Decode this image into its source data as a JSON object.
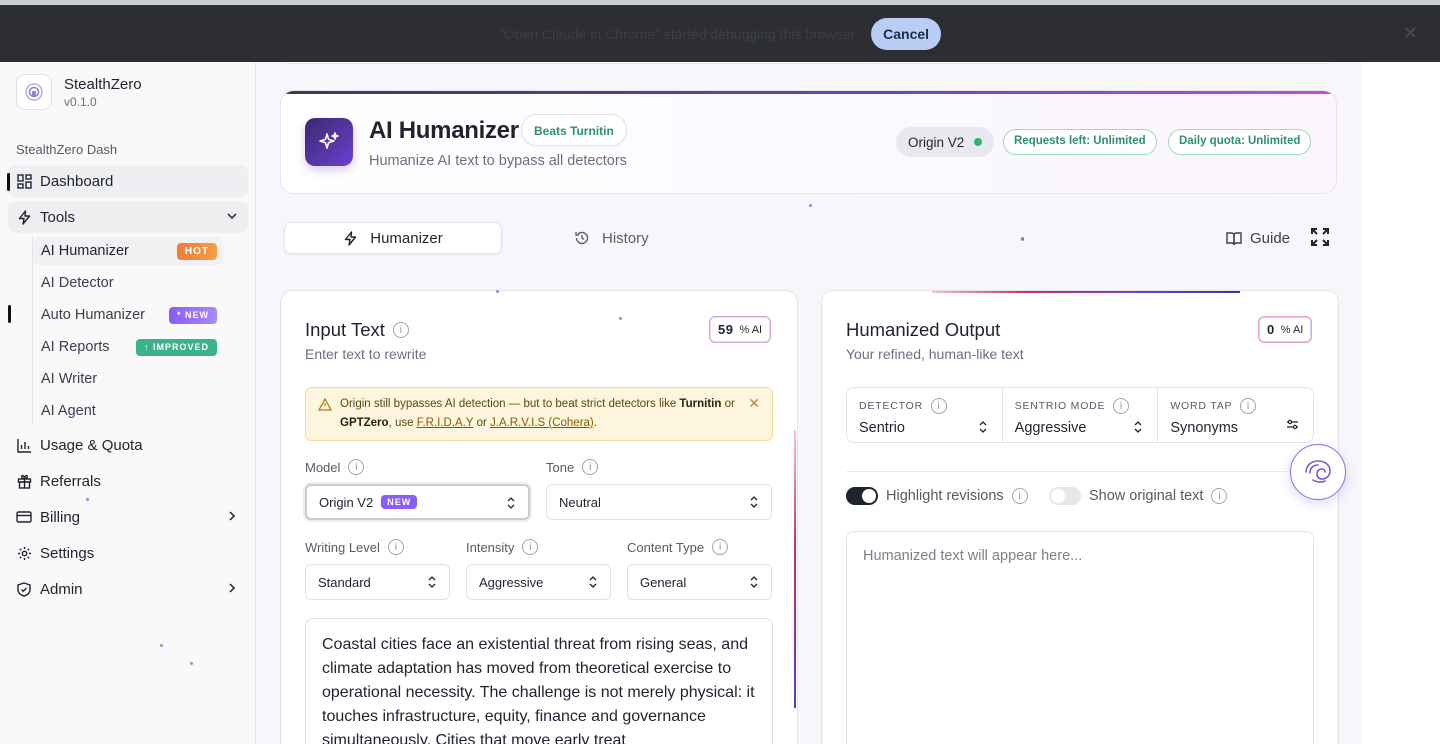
{
  "debug_bar": {
    "message": "\"Open Claude in Chrome\" started debugging this browser",
    "cancel_label": "Cancel",
    "close_glyph": "✕"
  },
  "sidebar": {
    "brand_name": "StealthZero",
    "brand_version": "v0.1.0",
    "section_label": "StealthZero Dash",
    "items": [
      {
        "label": "Dashboard",
        "icon": "dashboard-icon"
      },
      {
        "label": "Tools",
        "icon": "bolt-icon"
      },
      {
        "label": "Usage & Quota",
        "icon": "bar-chart-icon"
      },
      {
        "label": "Referrals",
        "icon": "gift-icon"
      },
      {
        "label": "Billing",
        "icon": "credit-card-icon"
      },
      {
        "label": "Settings",
        "icon": "gear-icon"
      },
      {
        "label": "Admin",
        "icon": "shield-icon"
      }
    ],
    "tools": [
      {
        "label": "AI Humanizer",
        "badge": "HOT"
      },
      {
        "label": "AI Detector",
        "badge": ""
      },
      {
        "label": "Auto Humanizer",
        "badge": "* NEW"
      },
      {
        "label": "AI Reports",
        "badge": "↑ IMPROVED"
      },
      {
        "label": "AI Writer",
        "badge": ""
      },
      {
        "label": "AI Agent",
        "badge": ""
      }
    ]
  },
  "header": {
    "title": "AI Humanizer",
    "chip": "Beats Turnitin",
    "subtitle": "Humanize AI text to bypass all detectors",
    "model": "Origin V2",
    "requests": "Requests left: Unlimited",
    "quota": "Daily quota: Unlimited"
  },
  "tabs": {
    "humanizer": "Humanizer",
    "history": "History",
    "guide": "Guide"
  },
  "input": {
    "title": "Input Text",
    "subtitle": "Enter text to rewrite",
    "ai_percent": "59",
    "ai_unit": "% AI",
    "warning": {
      "pre": "Origin still bypasses AI detection — but to beat strict detectors like ",
      "turnitin": "Turnitin",
      "or": " or ",
      "gptzero": "GPTZero",
      "use": ", use ",
      "friday": "F.R.I.D.A.Y",
      "or2": " or ",
      "jarvis": "J.A.R.V.I.S (Cohera)",
      "end": "."
    },
    "model_label": "Model",
    "model_value": "Origin V2",
    "model_badge": "NEW",
    "tone_label": "Tone",
    "tone_value": "Neutral",
    "writing_level_label": "Writing Level",
    "writing_level_value": "Standard",
    "intensity_label": "Intensity",
    "intensity_value": "Aggressive",
    "content_type_label": "Content Type",
    "content_type_value": "General",
    "text": "Coastal cities face an existential threat from rising seas, and climate adaptation has moved from theoretical exercise to operational necessity. The challenge is not merely physical: it touches infrastructure, equity, finance and governance simultaneously. Cities that move early treat"
  },
  "output": {
    "title": "Humanized Output",
    "subtitle": "Your refined, human-like text",
    "ai_percent": "0",
    "ai_unit": "% AI",
    "detector_label": "DETECTOR",
    "detector_value": "Sentrio",
    "mode_label": "SENTRIO MODE",
    "mode_value": "Aggressive",
    "word_tap_label": "WORD TAP",
    "word_tap_value": "Synonyms",
    "highlight_label": "Highlight revisions",
    "highlight_on": true,
    "original_label": "Show original text",
    "original_on": false,
    "placeholder": "Humanized text will appear here..."
  },
  "colors": {
    "accent": "#6d3fd0",
    "success": "#2f8f6e",
    "hot": "#f07a3c",
    "new": "#8b5cf6",
    "improved": "#3bb38a"
  }
}
